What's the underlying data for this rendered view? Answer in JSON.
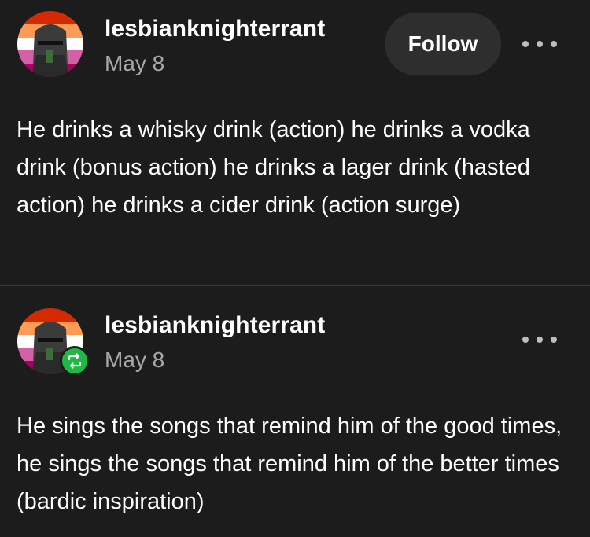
{
  "posts": [
    {
      "username": "lesbianknighterrant",
      "date": "May 8",
      "follow_label": "Follow",
      "avatar_icon": "knight-helmet-avatar",
      "more_icon": "more-options-icon",
      "text": "He drinks a whisky drink (action) he drinks a vodka drink (bonus action) he drinks a lager drink (hasted action) he drinks a cider drink (action surge)"
    },
    {
      "username": "lesbianknighterrant",
      "date": "May 8",
      "avatar_icon": "knight-helmet-avatar",
      "badge_icon": "reblog-icon",
      "more_icon": "more-options-icon",
      "text": "He sings the songs that remind him of the good times, he sings the songs that remind him of the better times (bardic inspiration)"
    }
  ],
  "colors": {
    "background": "#1c1c1c",
    "text": "#ffffff",
    "muted": "#a8a8a8",
    "button_bg": "#2e2e2e",
    "reblog_green": "#1eba45",
    "flag_stripes": [
      "#d62900",
      "#ff9b55",
      "#ffffff",
      "#d461a6",
      "#a50062"
    ]
  }
}
